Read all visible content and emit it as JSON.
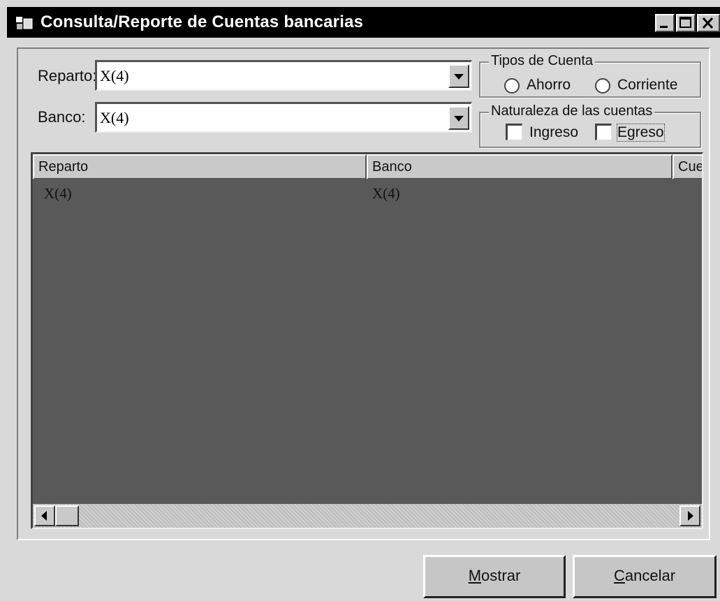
{
  "window": {
    "title": "Consulta/Reporte de Cuentas bancarias"
  },
  "filters": {
    "reparto_label": "Reparto:",
    "reparto_value": "X(4)",
    "banco_label": "Banco:",
    "banco_value": "X(4)"
  },
  "tipos_cuenta": {
    "title": "Tipos de Cuenta",
    "options": [
      "Ahorro",
      "Corriente"
    ]
  },
  "naturaleza": {
    "title": "Naturaleza de las cuentas",
    "options": [
      "Ingreso",
      "Egreso"
    ]
  },
  "grid": {
    "columns": [
      "Reparto",
      "Banco",
      "Cue"
    ],
    "rows": [
      [
        "X(4)",
        "X(4)"
      ]
    ]
  },
  "buttons": {
    "mostrar_mnemonic": "M",
    "mostrar_rest": "ostrar",
    "cancelar_mnemonic": "C",
    "cancelar_rest": "ancelar"
  }
}
